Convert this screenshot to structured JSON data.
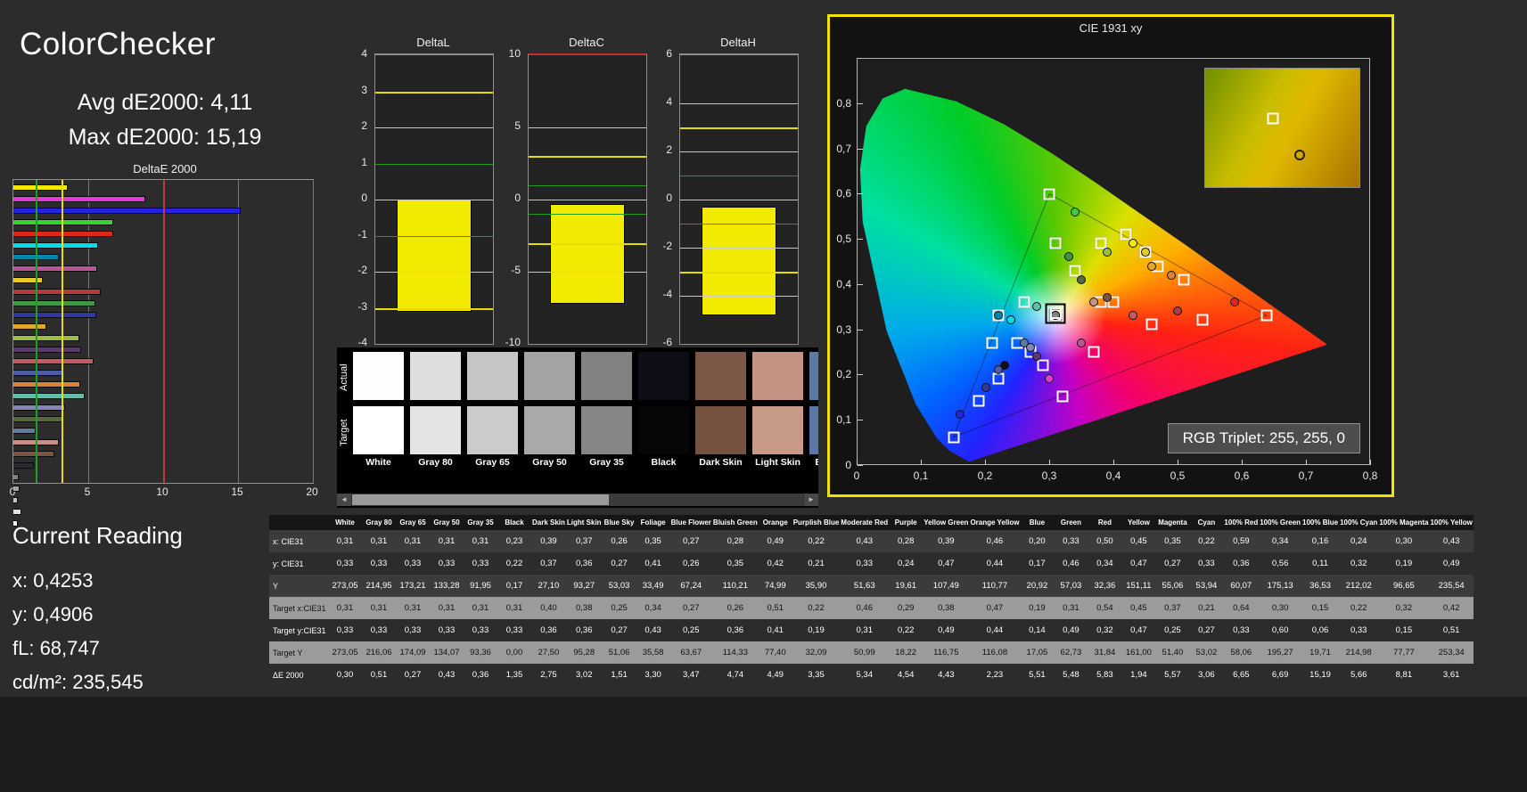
{
  "header": {
    "title": "ColorChecker",
    "avg": "Avg dE2000: 4,11",
    "max": "Max dE2000: 15,19"
  },
  "current_reading": {
    "title": "Current Reading",
    "lines": [
      "x: 0,4253",
      "y: 0,4906",
      "fL: 68,747",
      "cd/m²: 235,545"
    ]
  },
  "deltae_chart": {
    "title": "DeltaE 2000",
    "xmax": 20,
    "x_ticks": [
      0,
      5,
      10,
      15,
      20
    ],
    "ref_lines": [
      {
        "value": 1.5,
        "color": "#1f9e1f"
      },
      {
        "value": 3.2,
        "color": "#e6de00"
      },
      {
        "value": 10,
        "color": "#c03a3a"
      }
    ],
    "bars": [
      {
        "name": "100% Yellow",
        "color": "#f2ea00",
        "value": "3,61"
      },
      {
        "name": "100% Magenta",
        "color": "#e23ad4",
        "value": "8,81"
      },
      {
        "name": "100% Blue",
        "color": "#2424e0",
        "value": "15,19"
      },
      {
        "name": "100% Green",
        "color": "#33d433",
        "value": "6,69"
      },
      {
        "name": "100% Red",
        "color": "#e3261a",
        "value": "6,65"
      },
      {
        "name": "100% Cyan",
        "color": "#00dce8",
        "value": "5,66"
      },
      {
        "name": "Cyan",
        "color": "#0088a8",
        "value": "3,06"
      },
      {
        "name": "Magenta",
        "color": "#bb5694",
        "value": "5,57"
      },
      {
        "name": "Yellow",
        "color": "#e8c928",
        "value": "1,94"
      },
      {
        "name": "Red",
        "color": "#b23a42",
        "value": "5,83"
      },
      {
        "name": "Green",
        "color": "#3f9548",
        "value": "5,48"
      },
      {
        "name": "Blue",
        "color": "#32389c",
        "value": "5,51"
      },
      {
        "name": "Orange Yellow",
        "color": "#e3a828",
        "value": "2,23"
      },
      {
        "name": "Yellow Green",
        "color": "#9cbd3f",
        "value": "4,43"
      },
      {
        "name": "Purple",
        "color": "#5d3a6d",
        "value": "4,54"
      },
      {
        "name": "Moderate Red",
        "color": "#c35a63",
        "value": "5,34"
      },
      {
        "name": "Purplish Blue",
        "color": "#4e5ba5",
        "value": "3,35"
      },
      {
        "name": "Orange",
        "color": "#d8823a",
        "value": "4,49"
      },
      {
        "name": "Bluish Green",
        "color": "#62bdad",
        "value": "4,74"
      },
      {
        "name": "Blue Flower",
        "color": "#8784b8",
        "value": "3,47"
      },
      {
        "name": "Foliage",
        "color": "#56693f",
        "value": "3,30"
      },
      {
        "name": "Blue Sky",
        "color": "#5d7aa1",
        "value": "1,51"
      },
      {
        "name": "Light Skin",
        "color": "#c49382",
        "value": "3,02"
      },
      {
        "name": "Dark Skin",
        "color": "#7a5647",
        "value": "2,75"
      },
      {
        "name": "Black",
        "color": "#2a2a33",
        "value": "1,35"
      },
      {
        "name": "Gray 35",
        "color": "#838383",
        "value": "0,36"
      },
      {
        "name": "Gray 50",
        "color": "#a5a5a5",
        "value": "0,43"
      },
      {
        "name": "Gray 65",
        "color": "#c6c6c6",
        "value": "0,27"
      },
      {
        "name": "Gray 80",
        "color": "#e2e2e2",
        "value": "0,51"
      },
      {
        "name": "White",
        "color": "#ffffff",
        "value": "0,30"
      }
    ]
  },
  "delta_charts": [
    {
      "title": "DeltaL",
      "min": -4,
      "max": 4,
      "ticks": [
        4,
        3,
        2,
        1,
        0,
        -1,
        -2,
        -3,
        -4
      ],
      "yellow_lines": [
        3,
        -3
      ],
      "green_lines": [
        1,
        -1
      ],
      "bar": {
        "from": 0,
        "to": -3.1
      },
      "top_border": "#8f8f8f"
    },
    {
      "title": "DeltaC",
      "min": -10,
      "max": 10,
      "ticks": [
        10,
        5,
        0,
        -5,
        -10
      ],
      "yellow_lines": [
        3,
        -3
      ],
      "green_lines": [
        1,
        -1
      ],
      "bar": {
        "from": -0.3,
        "to": -7.2
      },
      "top_border": "#c23030"
    },
    {
      "title": "DeltaH",
      "min": -6,
      "max": 6,
      "ticks": [
        6,
        4,
        2,
        0,
        -2,
        -4,
        -6
      ],
      "yellow_lines": [
        3,
        -3
      ],
      "green_lines": [
        1,
        -1
      ],
      "bar": {
        "from": -0.3,
        "to": -4.8
      },
      "top_border": "#8f8f8f"
    }
  ],
  "swatches": {
    "row_labels": [
      "Actual",
      "Target"
    ],
    "items": [
      {
        "label": "White",
        "actual": "#fdfdfd",
        "target": "#ffffff"
      },
      {
        "label": "Gray 80",
        "actual": "#dedede",
        "target": "#e4e4e4"
      },
      {
        "label": "Gray 65",
        "actual": "#c5c5c5",
        "target": "#cbcbcb"
      },
      {
        "label": "Gray 50",
        "actual": "#a4a4a4",
        "target": "#a9a9a9"
      },
      {
        "label": "Gray 35",
        "actual": "#828282",
        "target": "#868686"
      },
      {
        "label": "Black",
        "actual": "#0d0d15",
        "target": "#060606"
      },
      {
        "label": "Dark Skin",
        "actual": "#7b5747",
        "target": "#765340"
      },
      {
        "label": "Light Skin",
        "actual": "#c49383",
        "target": "#c89a88"
      },
      {
        "label": "Blue Sky",
        "actual": "#5d7aa1",
        "target": "#5a78a3"
      }
    ]
  },
  "cie": {
    "title": "CIE 1931 xy",
    "rgb_triplet": "RGB Triplet: 255, 255, 0",
    "x_max": 0.8,
    "y_max": 0.9,
    "x_ticks": [
      {
        "label": "0",
        "v": 0
      },
      {
        "label": "0,1",
        "v": 0.1
      },
      {
        "label": "0,2",
        "v": 0.2
      },
      {
        "label": "0,3",
        "v": 0.3
      },
      {
        "label": "0,4",
        "v": 0.4
      },
      {
        "label": "0,5",
        "v": 0.5
      },
      {
        "label": "0,6",
        "v": 0.6
      },
      {
        "label": "0,7",
        "v": 0.7
      },
      {
        "label": "0,8",
        "v": 0.8
      }
    ],
    "y_ticks": [
      {
        "label": "0",
        "v": 0
      },
      {
        "label": "0,1",
        "v": 0.1
      },
      {
        "label": "0,2",
        "v": 0.2
      },
      {
        "label": "0,3",
        "v": 0.3
      },
      {
        "label": "0,4",
        "v": 0.4
      },
      {
        "label": "0,5",
        "v": 0.5
      },
      {
        "label": "0,6",
        "v": 0.6
      },
      {
        "label": "0,7",
        "v": 0.7
      },
      {
        "label": "0,8",
        "v": 0.8
      }
    ],
    "triangle": [
      [
        0.64,
        0.33
      ],
      [
        0.3,
        0.6
      ],
      [
        0.15,
        0.06
      ]
    ],
    "selected": {
      "x": "0,31",
      "y": "0,335"
    }
  },
  "table": {
    "row_labels": [
      "x: CIE31",
      "y: CIE31",
      "Y",
      "Target x:CIE31",
      "Target y:CIE31",
      "Target Y",
      "ΔE 2000"
    ],
    "fields": [
      "x",
      "y",
      "Y",
      "tx",
      "ty",
      "tY",
      "dE"
    ],
    "row_styles": [
      {
        "bg": "#3b3b3b",
        "fg": "#ffffff"
      },
      {
        "bg": "#2c2c2c",
        "fg": "#ffffff"
      },
      {
        "bg": "#3b3b3b",
        "fg": "#ffffff"
      },
      {
        "bg": "#9b9b9b",
        "fg": "#101010"
      },
      {
        "bg": "#2c2c2c",
        "fg": "#ffffff"
      },
      {
        "bg": "#9b9b9b",
        "fg": "#101010"
      },
      {
        "bg": "#2c2c2c",
        "fg": "#ffffff"
      }
    ]
  },
  "patches": [
    {
      "name": "White",
      "color": "#ffffff",
      "x": "0,31",
      "y": "0,33",
      "Y": "273,05",
      "tx": "0,31",
      "ty": "0,33",
      "tY": "273,05",
      "dE": "0,30"
    },
    {
      "name": "Gray 80",
      "color": "#e2e2e2",
      "x": "0,31",
      "y": "0,33",
      "Y": "214,95",
      "tx": "0,31",
      "ty": "0,33",
      "tY": "216,06",
      "dE": "0,51"
    },
    {
      "name": "Gray 65",
      "color": "#c6c6c6",
      "x": "0,31",
      "y": "0,33",
      "Y": "173,21",
      "tx": "0,31",
      "ty": "0,33",
      "tY": "174,09",
      "dE": "0,27"
    },
    {
      "name": "Gray 50",
      "color": "#a5a5a5",
      "x": "0,31",
      "y": "0,33",
      "Y": "133,28",
      "tx": "0,31",
      "ty": "0,33",
      "tY": "134,07",
      "dE": "0,43"
    },
    {
      "name": "Gray 35",
      "color": "#838383",
      "x": "0,31",
      "y": "0,33",
      "Y": "91,95",
      "tx": "0,31",
      "ty": "0,33",
      "tY": "93,36",
      "dE": "0,36"
    },
    {
      "name": "Black",
      "color": "#10101a",
      "x": "0,23",
      "y": "0,22",
      "Y": "0,17",
      "tx": "0,31",
      "ty": "0,33",
      "tY": "0,00",
      "dE": "1,35"
    },
    {
      "name": "Dark Skin",
      "color": "#7a5647",
      "x": "0,39",
      "y": "0,37",
      "Y": "27,10",
      "tx": "0,40",
      "ty": "0,36",
      "tY": "27,50",
      "dE": "2,75"
    },
    {
      "name": "Light Skin",
      "color": "#c49382",
      "x": "0,37",
      "y": "0,36",
      "Y": "93,27",
      "tx": "0,38",
      "ty": "0,36",
      "tY": "95,28",
      "dE": "3,02"
    },
    {
      "name": "Blue Sky",
      "color": "#5d7aa1",
      "x": "0,26",
      "y": "0,27",
      "Y": "53,03",
      "tx": "0,25",
      "ty": "0,27",
      "tY": "51,06",
      "dE": "1,51"
    },
    {
      "name": "Foliage",
      "color": "#56693f",
      "x": "0,35",
      "y": "0,41",
      "Y": "33,49",
      "tx": "0,34",
      "ty": "0,43",
      "tY": "35,58",
      "dE": "3,30"
    },
    {
      "name": "Blue Flower",
      "color": "#8784b8",
      "x": "0,27",
      "y": "0,26",
      "Y": "67,24",
      "tx": "0,27",
      "ty": "0,25",
      "tY": "63,67",
      "dE": "3,47"
    },
    {
      "name": "Bluish Green",
      "color": "#62bdad",
      "x": "0,28",
      "y": "0,35",
      "Y": "110,21",
      "tx": "0,26",
      "ty": "0,36",
      "tY": "114,33",
      "dE": "4,74"
    },
    {
      "name": "Orange",
      "color": "#d8823a",
      "x": "0,49",
      "y": "0,42",
      "Y": "74,99",
      "tx": "0,51",
      "ty": "0,41",
      "tY": "77,40",
      "dE": "4,49"
    },
    {
      "name": "Purplish Blue",
      "color": "#4e5ba5",
      "x": "0,22",
      "y": "0,21",
      "Y": "35,90",
      "tx": "0,22",
      "ty": "0,19",
      "tY": "32,09",
      "dE": "3,35"
    },
    {
      "name": "Moderate Red",
      "color": "#c35a63",
      "x": "0,43",
      "y": "0,33",
      "Y": "51,63",
      "tx": "0,46",
      "ty": "0,31",
      "tY": "50,99",
      "dE": "5,34"
    },
    {
      "name": "Purple",
      "color": "#5d3a6d",
      "x": "0,28",
      "y": "0,24",
      "Y": "19,61",
      "tx": "0,29",
      "ty": "0,22",
      "tY": "18,22",
      "dE": "4,54"
    },
    {
      "name": "Yellow Green",
      "color": "#9cbd3f",
      "x": "0,39",
      "y": "0,47",
      "Y": "107,49",
      "tx": "0,38",
      "ty": "0,49",
      "tY": "116,75",
      "dE": "4,43"
    },
    {
      "name": "Orange Yellow",
      "color": "#e3a828",
      "x": "0,46",
      "y": "0,44",
      "Y": "110,77",
      "tx": "0,47",
      "ty": "0,44",
      "tY": "116,08",
      "dE": "2,23"
    },
    {
      "name": "Blue",
      "color": "#32389c",
      "x": "0,20",
      "y": "0,17",
      "Y": "20,92",
      "tx": "0,19",
      "ty": "0,14",
      "tY": "17,05",
      "dE": "5,51"
    },
    {
      "name": "Green",
      "color": "#3f9548",
      "x": "0,33",
      "y": "0,46",
      "Y": "57,03",
      "tx": "0,31",
      "ty": "0,49",
      "tY": "62,73",
      "dE": "5,48"
    },
    {
      "name": "Red",
      "color": "#b23a42",
      "x": "0,50",
      "y": "0,34",
      "Y": "32,36",
      "tx": "0,54",
      "ty": "0,32",
      "tY": "31,84",
      "dE": "5,83"
    },
    {
      "name": "Yellow",
      "color": "#e8c928",
      "x": "0,45",
      "y": "0,47",
      "Y": "151,11",
      "tx": "0,45",
      "ty": "0,47",
      "tY": "161,00",
      "dE": "1,94"
    },
    {
      "name": "Magenta",
      "color": "#bb5694",
      "x": "0,35",
      "y": "0,27",
      "Y": "55,06",
      "tx": "0,37",
      "ty": "0,25",
      "tY": "51,40",
      "dE": "5,57"
    },
    {
      "name": "Cyan",
      "color": "#0088a8",
      "x": "0,22",
      "y": "0,33",
      "Y": "53,94",
      "tx": "0,21",
      "ty": "0,27",
      "tY": "53,02",
      "dE": "3,06"
    },
    {
      "name": "100% Red",
      "color": "#e3261a",
      "x": "0,59",
      "y": "0,36",
      "Y": "60,07",
      "tx": "0,64",
      "ty": "0,33",
      "tY": "58,06",
      "dE": "6,65"
    },
    {
      "name": "100% Green",
      "color": "#33d433",
      "x": "0,34",
      "y": "0,56",
      "Y": "175,13",
      "tx": "0,30",
      "ty": "0,60",
      "tY": "195,27",
      "dE": "6,69"
    },
    {
      "name": "100% Blue",
      "color": "#2424e0",
      "x": "0,16",
      "y": "0,11",
      "Y": "36,53",
      "tx": "0,15",
      "ty": "0,06",
      "tY": "19,71",
      "dE": "15,19"
    },
    {
      "name": "100% Cyan",
      "color": "#00dce8",
      "x": "0,24",
      "y": "0,32",
      "Y": "212,02",
      "tx": "0,22",
      "ty": "0,33",
      "tY": "214,98",
      "dE": "5,66"
    },
    {
      "name": "100% Magenta",
      "color": "#e23ad4",
      "x": "0,30",
      "y": "0,19",
      "Y": "96,65",
      "tx": "0,32",
      "ty": "0,15",
      "tY": "77,77",
      "dE": "8,81"
    },
    {
      "name": "100% Yellow",
      "color": "#f2ea00",
      "x": "0,43",
      "y": "0,49",
      "Y": "235,54",
      "tx": "0,42",
      "ty": "0,51",
      "tY": "253,34",
      "dE": "3,61"
    }
  ]
}
